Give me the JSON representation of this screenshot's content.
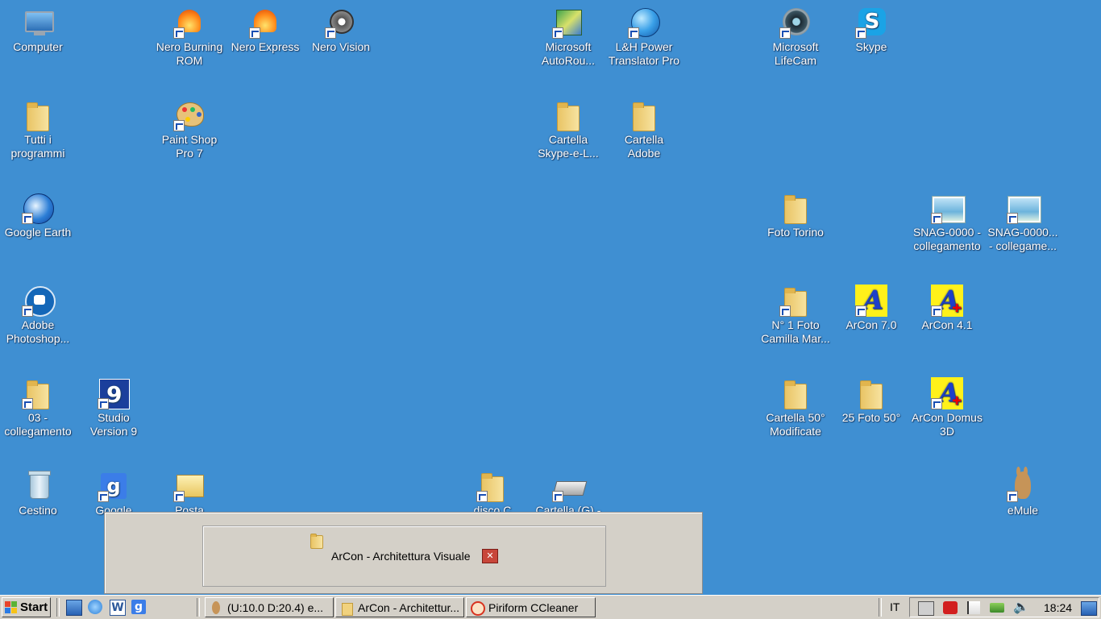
{
  "desktop": {
    "icons": [
      {
        "label": "Computer",
        "icon": "computer-icon"
      },
      {
        "label": "Nero Burning ROM",
        "icon": "nero-flame-icon"
      },
      {
        "label": "Nero Express",
        "icon": "nero-flame-icon"
      },
      {
        "label": "Nero Vision",
        "icon": "film-reel-icon"
      },
      {
        "label": "Microsoft AutoRou...",
        "icon": "map-icon"
      },
      {
        "label": "L&H Power Translator Pro",
        "icon": "globe-icon"
      },
      {
        "label": "Microsoft LifeCam",
        "icon": "webcam-icon"
      },
      {
        "label": "Skype",
        "icon": "skype-icon"
      },
      {
        "label": "Tutti i programmi",
        "icon": "folder-icon"
      },
      {
        "label": "Paint Shop Pro 7",
        "icon": "palette-icon"
      },
      {
        "label": "Cartella Skype-e-L...",
        "icon": "folder-icon"
      },
      {
        "label": "Cartella Adobe",
        "icon": "folder-icon"
      },
      {
        "label": "Google Earth",
        "icon": "google-earth-icon"
      },
      {
        "label": "Foto Torino",
        "icon": "folder-icon"
      },
      {
        "label": "SNAG-0000 - collegamento",
        "icon": "image-file-icon"
      },
      {
        "label": "SNAG-0000... - collegame...",
        "icon": "image-file-icon"
      },
      {
        "label": "Adobe Photoshop...",
        "icon": "photoshop-icon"
      },
      {
        "label": "N° 1 Foto Camilla Mar...",
        "icon": "folder-icon"
      },
      {
        "label": "ArCon 7.0",
        "icon": "arcon-icon"
      },
      {
        "label": "ArCon 4.1",
        "icon": "arcon-icon"
      },
      {
        "label": "03 - collegamento",
        "icon": "folder-icon"
      },
      {
        "label": "Studio Version 9",
        "icon": "studio-icon"
      },
      {
        "label": "Cartella 50° Modificate",
        "icon": "folder-icon"
      },
      {
        "label": "25 Foto 50°",
        "icon": "folder-icon"
      },
      {
        "label": "ArCon Domus 3D",
        "icon": "arcon-icon"
      },
      {
        "label": "Cestino",
        "icon": "recycle-bin-icon"
      },
      {
        "label": "Google",
        "icon": "google-icon"
      },
      {
        "label": "Posta",
        "icon": "mail-icon"
      },
      {
        "label": "disco C",
        "icon": "folder-icon"
      },
      {
        "label": "Cartella (G) -",
        "icon": "drive-icon"
      },
      {
        "label": "eMule",
        "icon": "emule-icon"
      }
    ]
  },
  "popup": {
    "text": "ArCon - Architettura Visuale",
    "close_glyph": "✕"
  },
  "taskbar": {
    "start_label": "Start",
    "quicklaunch": [
      "show-desktop-icon",
      "internet-explorer-icon",
      "word-icon",
      "google-icon"
    ],
    "tasks": [
      {
        "label": "(U:10.0 D:20.4) e...",
        "icon": "emule-icon"
      },
      {
        "label": "ArCon - Architettur...",
        "icon": "folder-icon"
      },
      {
        "label": "Piriform CCleaner",
        "icon": "ccleaner-icon"
      }
    ],
    "language": "IT",
    "clock": "18:24",
    "tray_icons": [
      "network-icon",
      "antivirus-icon",
      "flag-icon",
      "safely-remove-icon",
      "volume-icon",
      "monitor-icon"
    ]
  },
  "colors": {
    "desktop_bg": "#3f8fd2",
    "taskbar_bg": "#d4d0c8"
  }
}
